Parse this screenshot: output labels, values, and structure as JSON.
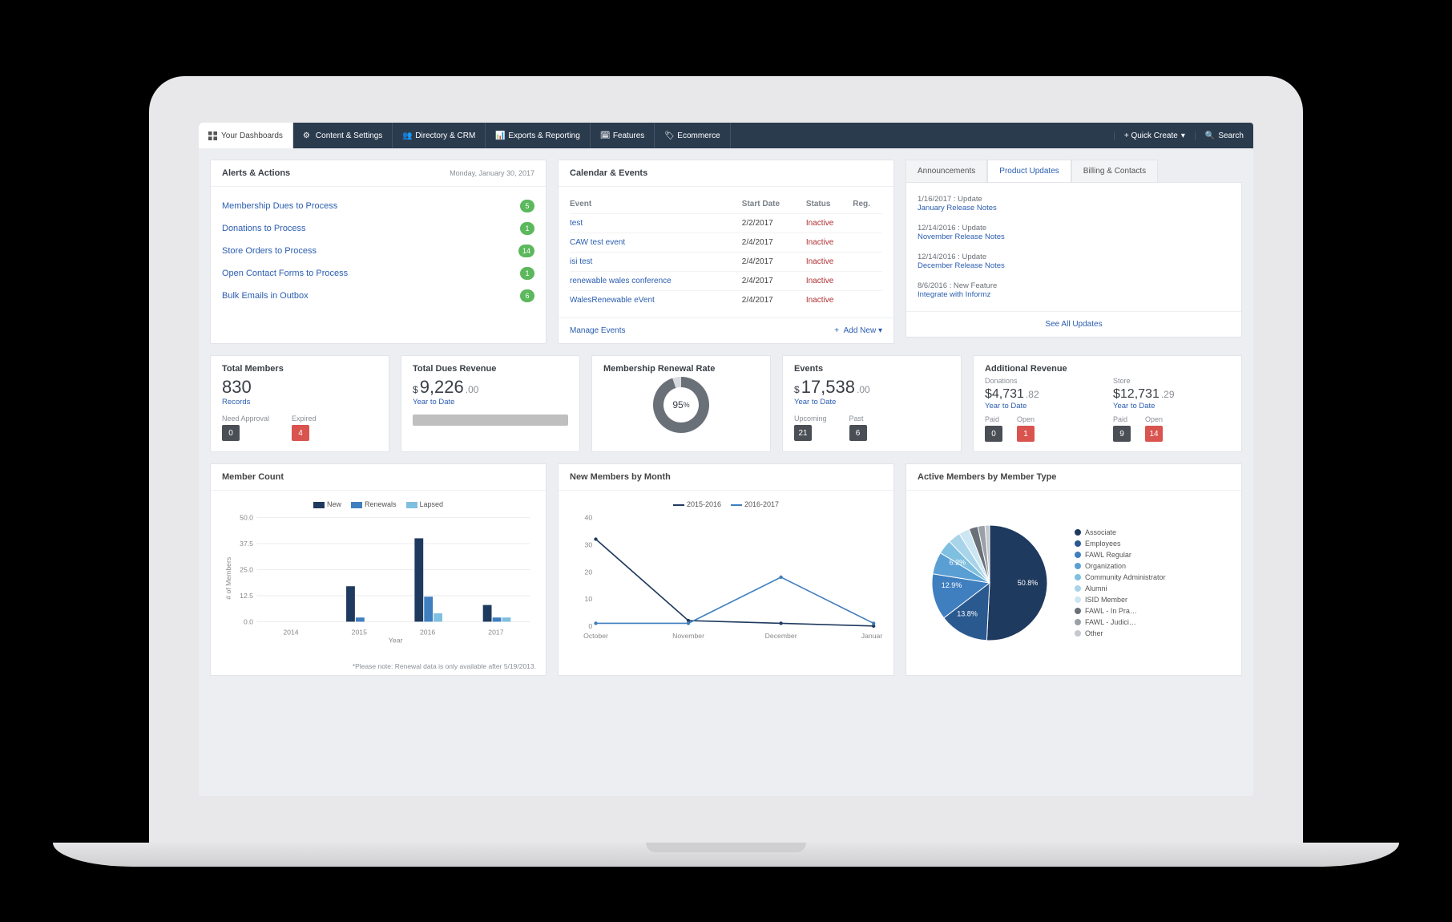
{
  "nav": {
    "dashboards": "Your Dashboards",
    "items": [
      "Content & Settings",
      "Directory & CRM",
      "Exports & Reporting",
      "Features",
      "Ecommerce"
    ],
    "quick_create": "+ Quick Create",
    "search": "Search"
  },
  "alerts": {
    "title": "Alerts & Actions",
    "date": "Monday, January 30, 2017",
    "items": [
      {
        "label": "Membership Dues to Process",
        "count": "5"
      },
      {
        "label": "Donations to Process",
        "count": "1"
      },
      {
        "label": "Store Orders to Process",
        "count": "14"
      },
      {
        "label": "Open Contact Forms to Process",
        "count": "1"
      },
      {
        "label": "Bulk Emails in Outbox",
        "count": "6"
      }
    ]
  },
  "events": {
    "title": "Calendar & Events",
    "cols": [
      "Event",
      "Start Date",
      "Status",
      "Reg."
    ],
    "rows": [
      {
        "name": "test",
        "date": "2/2/2017",
        "status": "Inactive"
      },
      {
        "name": "CAW test event",
        "date": "2/4/2017",
        "status": "Inactive"
      },
      {
        "name": "isi test",
        "date": "2/4/2017",
        "status": "Inactive"
      },
      {
        "name": "renewable wales conference",
        "date": "2/4/2017",
        "status": "Inactive"
      },
      {
        "name": "WalesRenewable eVent",
        "date": "2/4/2017",
        "status": "Inactive"
      }
    ],
    "manage": "Manage Events",
    "add_new": "Add New"
  },
  "announce": {
    "tabs": [
      "Announcements",
      "Product Updates",
      "Billing & Contacts"
    ],
    "active_tab": 1,
    "items": [
      {
        "meta": "1/16/2017 : Update",
        "link": "January Release Notes"
      },
      {
        "meta": "12/14/2016 : Update",
        "link": "November Release Notes"
      },
      {
        "meta": "12/14/2016 : Update",
        "link": "December Release Notes"
      },
      {
        "meta": "8/6/2016 : New Feature",
        "link": "Integrate with Informz"
      }
    ],
    "see_all": "See All Updates"
  },
  "metrics": {
    "total_members": {
      "title": "Total Members",
      "value": "830",
      "sub": "Records",
      "need_label": "Need Approval",
      "need": "0",
      "exp_label": "Expired",
      "exp": "4"
    },
    "dues": {
      "title": "Total Dues Revenue",
      "currency": "$",
      "value": "9,226",
      "dec": ".00",
      "sub": "Year to Date"
    },
    "renewal": {
      "title": "Membership Renewal Rate",
      "value": "95",
      "pct": "%"
    },
    "events_m": {
      "title": "Events",
      "currency": "$",
      "value": "17,538",
      "dec": ".00",
      "sub": "Year to Date",
      "up_label": "Upcoming",
      "up": "21",
      "past_label": "Past",
      "past": "6"
    },
    "addl": {
      "title": "Additional Revenue",
      "don_label": "Donations",
      "don_val": "$4,731",
      "don_dec": ".82",
      "don_sub": "Year to Date",
      "store_label": "Store",
      "store_val": "$12,731",
      "store_dec": ".29",
      "store_sub": "Year to Date",
      "paid_l": "Paid",
      "open_l": "Open",
      "d_paid": "0",
      "d_open": "1",
      "s_paid": "9",
      "s_open": "14"
    }
  },
  "charts": {
    "member_count": {
      "title": "Member Count",
      "legend": [
        "New",
        "Renewals",
        "Lapsed"
      ],
      "note": "*Please note: Renewal data is only available after 5/19/2013.",
      "xlabel": "Year",
      "ylabel": "# of Members"
    },
    "new_members": {
      "title": "New Members by Month",
      "legend": [
        "2015-2016",
        "2016-2017"
      ]
    },
    "pie": {
      "title": "Active Members by Member Type",
      "labels": [
        "50.8%",
        "13.8%",
        "12.9%",
        "6.2%"
      ],
      "legend": [
        "Associate",
        "Employees",
        "FAWL Regular",
        "Organization",
        "Community Administrator",
        "Alumni",
        "ISID Member",
        "FAWL - In Pra…",
        "FAWL - Judici…",
        "Other"
      ]
    }
  },
  "chart_data": [
    {
      "type": "bar",
      "title": "Member Count",
      "xlabel": "Year",
      "ylabel": "# of Members",
      "ylim": [
        0,
        50
      ],
      "categories": [
        "2014",
        "2015",
        "2016",
        "2017"
      ],
      "series": [
        {
          "name": "New",
          "values": [
            0,
            17,
            40,
            8
          ]
        },
        {
          "name": "Renewals",
          "values": [
            0,
            2,
            12,
            2
          ]
        },
        {
          "name": "Lapsed",
          "values": [
            0,
            0,
            4,
            2
          ]
        }
      ]
    },
    {
      "type": "line",
      "title": "New Members by Month",
      "ylim": [
        0,
        40
      ],
      "categories": [
        "October",
        "November",
        "December",
        "January"
      ],
      "series": [
        {
          "name": "2015-2016",
          "values": [
            32,
            2,
            1,
            0
          ]
        },
        {
          "name": "2016-2017",
          "values": [
            1,
            1,
            18,
            1
          ]
        }
      ]
    },
    {
      "type": "pie",
      "title": "Active Members by Member Type",
      "series": [
        {
          "name": "Associate",
          "value": 50.8
        },
        {
          "name": "Employees",
          "value": 13.8
        },
        {
          "name": "FAWL Regular",
          "value": 12.9
        },
        {
          "name": "Organization",
          "value": 6.2
        },
        {
          "name": "Community Administrator",
          "value": 4.0
        },
        {
          "name": "Alumni",
          "value": 3.5
        },
        {
          "name": "ISID Member",
          "value": 3.0
        },
        {
          "name": "FAWL - In Pra…",
          "value": 2.5
        },
        {
          "name": "FAWL - Judici…",
          "value": 2.0
        },
        {
          "name": "Other",
          "value": 1.3
        }
      ]
    }
  ]
}
